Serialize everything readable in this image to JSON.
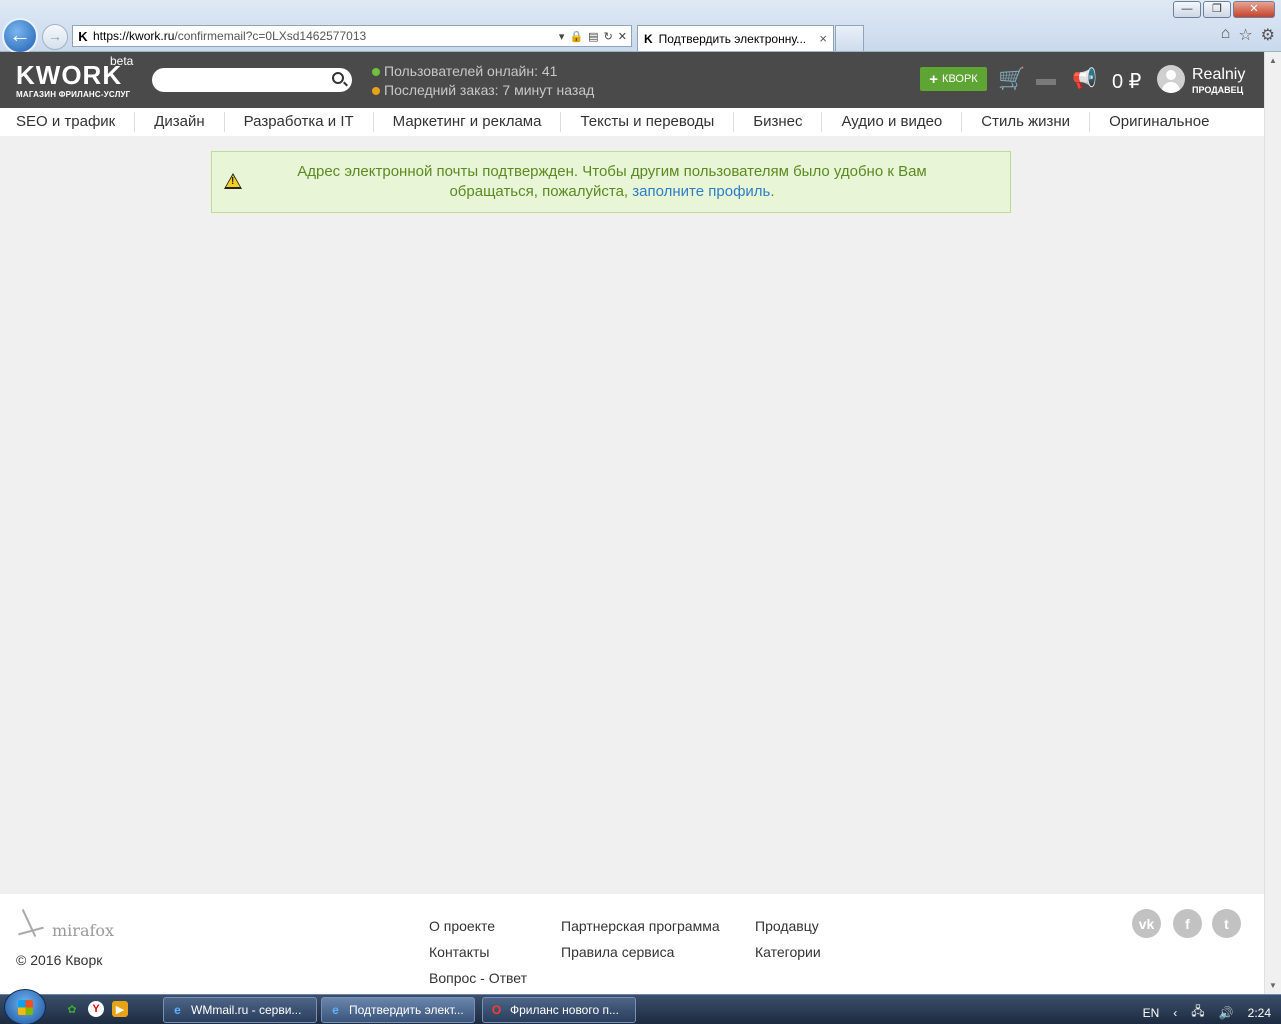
{
  "browser": {
    "window_controls": {
      "minimize": "—",
      "restore": "❐",
      "close": "✕"
    },
    "address": {
      "scheme": "https://",
      "host": "kwork.ru",
      "path": "/confirmemail?c=0LXsd1462577013",
      "favicon": "K"
    },
    "tabs": [
      {
        "label": "Подтвердить электронну...",
        "favicon": "K",
        "close": "×"
      }
    ],
    "icons": [
      "home-icon",
      "star-icon",
      "gear-icon"
    ]
  },
  "header": {
    "logo": "KWORK",
    "logo_beta": "beta",
    "logo_subtitle": "МАГАЗИН ФРИЛАНС-УСЛУГ",
    "stats": {
      "online": "Пользователей онлайн: 41",
      "last_order": "Последний заказ: 7 минут назад"
    },
    "add_kwork": "КВОРК",
    "balance": "0 ₽",
    "user": {
      "name": "Realniy",
      "role": "ПРОДАВЕЦ"
    }
  },
  "categories": [
    "SEO и трафик",
    "Дизайн",
    "Разработка и IT",
    "Маркетинг и реклама",
    "Тексты и переводы",
    "Бизнес",
    "Аудио и видео",
    "Стиль жизни",
    "Оригинальное"
  ],
  "alert": {
    "text_before": "Адрес электронной почты подтвержден. Чтобы другим пользователям было удобно к Вам обращаться, пожалуйста,",
    "link": "заполните профиль",
    "text_after": "."
  },
  "footer": {
    "brand": "mirafox",
    "copyright": "© 2016 Кворк",
    "col1": [
      "О проекте",
      "Контакты",
      "Вопрос - Ответ"
    ],
    "col2": [
      "Партнерская программа",
      "Правила сервиса"
    ],
    "col3": [
      "Продавцу",
      "Категории"
    ],
    "social": {
      "vk": "vk",
      "fb": "f",
      "tw": "t"
    }
  },
  "taskbar": {
    "apps": [
      {
        "label": "WMmail.ru - серви...",
        "icon": "e"
      },
      {
        "label": "Подтвердить элект...",
        "icon": "e"
      },
      {
        "label": "Фриланс нового п...",
        "icon": "O"
      }
    ],
    "lang": "EN",
    "clock": "2:24"
  },
  "colors": {
    "header_bg": "#4a4a4a",
    "accent_green": "#5ea533",
    "alert_bg": "#e8f5d6",
    "alert_text": "#5b8a22",
    "link": "#2d7ec5",
    "online_dot": "#6fc13b",
    "order_dot": "#e8a317"
  }
}
